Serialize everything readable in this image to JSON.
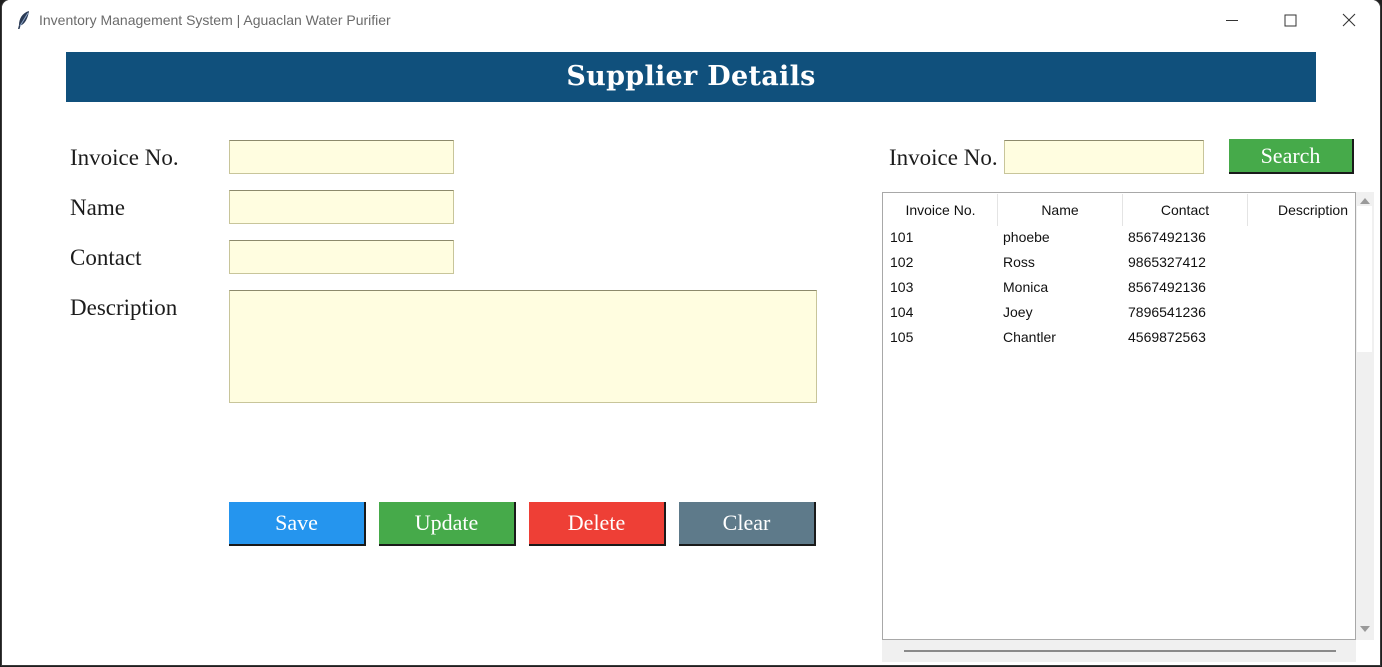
{
  "window": {
    "title": "Inventory Management System | Aguaclan Water Purifier",
    "icon": "feather-icon",
    "controls": [
      "minimize-icon",
      "maximize-icon",
      "close-icon"
    ]
  },
  "header": {
    "title": "Supplier Details",
    "background": "#10507c"
  },
  "form": {
    "invoice_label": "Invoice No.",
    "name_label": "Name",
    "contact_label": "Contact",
    "description_label": "Description",
    "invoice_value": "",
    "name_value": "",
    "contact_value": "",
    "description_value": "",
    "field_background": "#fffde0"
  },
  "buttons": {
    "save": "Save",
    "update": "Update",
    "delete": "Delete",
    "clear": "Clear",
    "colors": {
      "save": "#2595ee",
      "update": "#46aa4a",
      "delete": "#ee3f36",
      "clear": "#5e7a8a"
    }
  },
  "search": {
    "label": "Invoice No.",
    "value": "",
    "button": "Search",
    "button_color": "#46aa4a"
  },
  "table": {
    "columns": [
      "Invoice No.",
      "Name",
      "Contact",
      "Description"
    ],
    "rows": [
      {
        "invoice": "101",
        "name": "phoebe",
        "contact": "8567492136",
        "description": ""
      },
      {
        "invoice": "102",
        "name": "Ross",
        "contact": "9865327412",
        "description": ""
      },
      {
        "invoice": "103",
        "name": "Monica",
        "contact": "8567492136",
        "description": ""
      },
      {
        "invoice": "104",
        "name": "Joey",
        "contact": "7896541236",
        "description": ""
      },
      {
        "invoice": "105",
        "name": "Chantler",
        "contact": "4569872563",
        "description": ""
      }
    ]
  }
}
